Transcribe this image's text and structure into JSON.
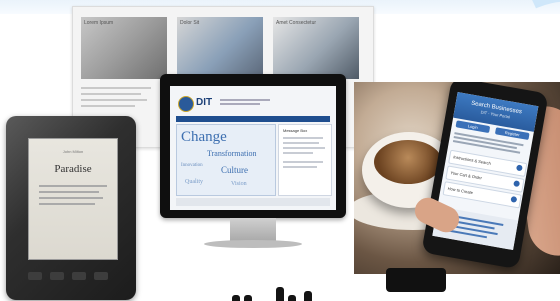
{
  "background_page": {
    "panel_titles": [
      "Lorem Ipsum",
      "Dolor Sit",
      "Amet Consectetur"
    ]
  },
  "ereader": {
    "book_title": "Paradise",
    "book_header": "John Milton"
  },
  "monitor": {
    "logo_text": "DIT",
    "hero_words": [
      "Change",
      "Transformation",
      "Innovation",
      "Culture",
      "Quality",
      "Vision"
    ],
    "side_title": "Message Box"
  },
  "phone": {
    "header_title": "Search Businesses",
    "header_subtitle": "DIT - Your Portal",
    "button_labels": [
      "Login",
      "Register"
    ],
    "rows": [
      "Instructions & Search",
      "Your Cart & Order",
      "How to Create"
    ]
  },
  "colors": {
    "accent": "#2a5c9e",
    "swoosh": "#cfe7fa"
  }
}
